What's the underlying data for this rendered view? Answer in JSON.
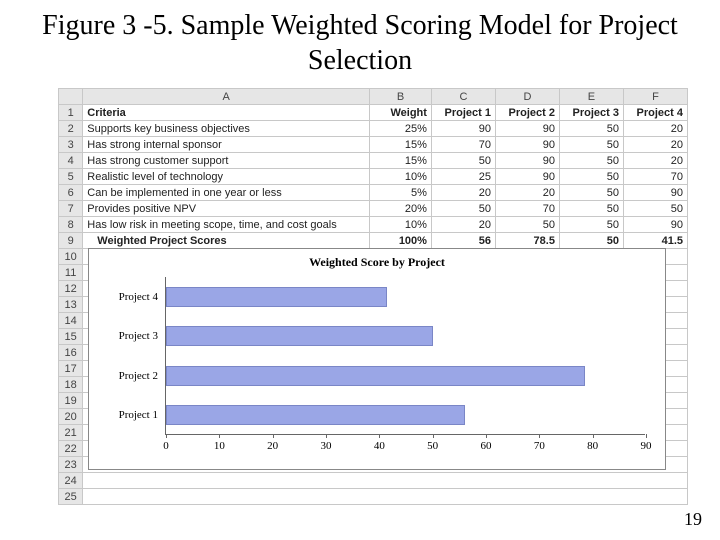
{
  "title": "Figure 3 -5. Sample Weighted Scoring Model for Project Selection",
  "page_number": "19",
  "spreadsheet": {
    "col_letters": [
      "A",
      "B",
      "C",
      "D",
      "E",
      "F"
    ],
    "row_numbers": [
      "1",
      "2",
      "3",
      "4",
      "5",
      "6",
      "7",
      "8",
      "9",
      "10",
      "11",
      "12",
      "13",
      "14",
      "15",
      "16",
      "17",
      "18",
      "19",
      "20",
      "21",
      "22",
      "23",
      "24",
      "25"
    ],
    "header": {
      "criteria": "Criteria",
      "weight": "Weight",
      "p1": "Project 1",
      "p2": "Project 2",
      "p3": "Project 3",
      "p4": "Project 4"
    },
    "rows": [
      {
        "label": "Supports key business objectives",
        "weight": "25%",
        "p1": "90",
        "p2": "90",
        "p3": "50",
        "p4": "20"
      },
      {
        "label": "Has strong internal sponsor",
        "weight": "15%",
        "p1": "70",
        "p2": "90",
        "p3": "50",
        "p4": "20"
      },
      {
        "label": "Has strong customer support",
        "weight": "15%",
        "p1": "50",
        "p2": "90",
        "p3": "50",
        "p4": "20"
      },
      {
        "label": "Realistic level of technology",
        "weight": "10%",
        "p1": "25",
        "p2": "90",
        "p3": "50",
        "p4": "70"
      },
      {
        "label": "Can be implemented in one year or less",
        "weight": "5%",
        "p1": "20",
        "p2": "20",
        "p3": "50",
        "p4": "90"
      },
      {
        "label": "Provides positive NPV",
        "weight": "20%",
        "p1": "50",
        "p2": "70",
        "p3": "50",
        "p4": "50"
      },
      {
        "label": "Has low risk in meeting scope, time, and cost goals",
        "weight": "10%",
        "p1": "20",
        "p2": "50",
        "p3": "50",
        "p4": "90"
      }
    ],
    "total": {
      "label": "Weighted Project Scores",
      "weight": "100%",
      "p1": "56",
      "p2": "78.5",
      "p3": "50",
      "p4": "41.5"
    }
  },
  "chart_data": {
    "type": "bar",
    "orientation": "horizontal",
    "title": "Weighted Score by Project",
    "xlabel": "",
    "ylabel": "",
    "xlim": [
      0,
      90
    ],
    "xticks": [
      0,
      10,
      20,
      30,
      40,
      50,
      60,
      70,
      80,
      90
    ],
    "categories": [
      "Project 4",
      "Project 3",
      "Project 2",
      "Project 1"
    ],
    "values": [
      41.5,
      50,
      78.5,
      56
    ]
  }
}
